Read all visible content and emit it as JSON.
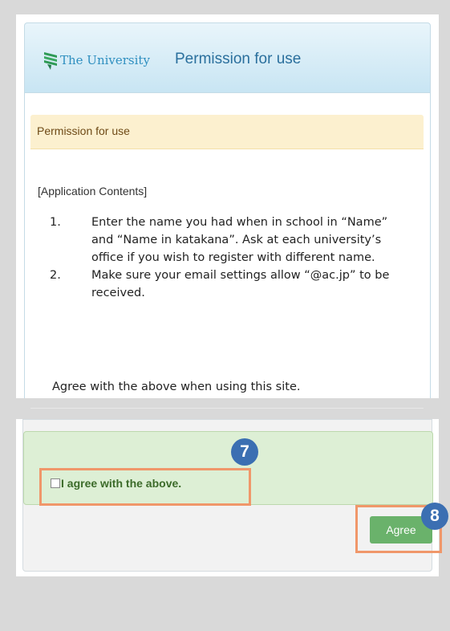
{
  "header": {
    "logo_text": "The University",
    "title": "Permission for use"
  },
  "notice": {
    "heading": "Permission for use",
    "section_label": "[Application Contents]",
    "rules": [
      {
        "num": "1.",
        "text": "Enter the name you had when in school in “Name” and “Name in katakana”. Ask at each university’s office if you wish to register with different name."
      },
      {
        "num": "2.",
        "text": "Make sure your email settings allow “@ac.jp” to be received."
      }
    ],
    "agree_text": "Agree with the above when using this site."
  },
  "form": {
    "checkbox_label": "I agree with the above.",
    "checkbox_checked": false,
    "agree_button": "Agree"
  },
  "annotations": {
    "badge_7": "7",
    "badge_8": "8",
    "badge_color": "#3b6fb2",
    "highlight_color": "#f0976a"
  },
  "colors": {
    "header_title": "#2a6f9d",
    "notice_bg": "#fcf0cf",
    "green_bg": "#ddefd5",
    "button_bg": "#6ab26b"
  }
}
